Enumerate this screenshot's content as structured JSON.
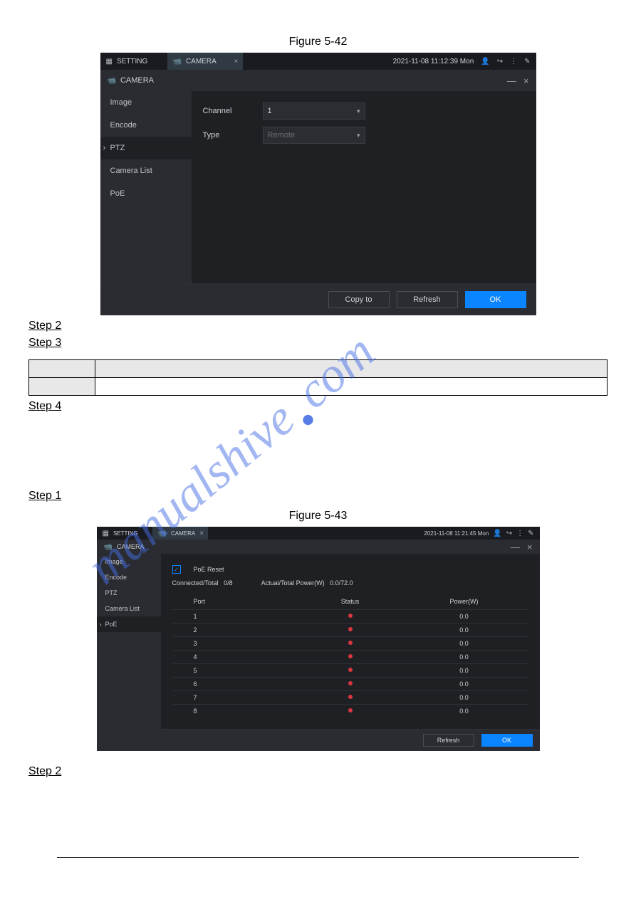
{
  "watermark": {
    "part1": "manualshive",
    "dot": ".",
    "part2": "com"
  },
  "figure1": {
    "caption": "Figure 5-42",
    "topbar": {
      "tab_setting": "SETTING",
      "tab_camera": "CAMERA",
      "datetime": "2021-11-08 11:12:39 Mon"
    },
    "subbar": {
      "title": "CAMERA"
    },
    "sidebar": {
      "items": [
        "Image",
        "Encode",
        "PTZ",
        "Camera List",
        "PoE"
      ],
      "active": 2
    },
    "form": {
      "rows": [
        {
          "label": "Channel",
          "value": "1",
          "disabled": false
        },
        {
          "label": "Type",
          "value": "Remote",
          "disabled": true
        }
      ]
    },
    "footer": {
      "copy": "Copy to",
      "refresh": "Refresh",
      "ok": "OK"
    }
  },
  "figure2": {
    "caption": "Figure 5-43",
    "topbar": {
      "tab_setting": "SETTING",
      "tab_camera": "CAMERA",
      "datetime": "2021-11-08 11:21:45 Mon"
    },
    "subbar": {
      "title": "CAMERA"
    },
    "sidebar": {
      "items": [
        "Image",
        "Encode",
        "PTZ",
        "Camera List",
        "PoE"
      ],
      "active": 4
    },
    "poe": {
      "checkbox_label": "PoE Reset",
      "stats": {
        "connected_label": "Connected/Total",
        "connected_val": "0/8",
        "power_label": "Actual/Total Power(W)",
        "power_val": "0.0/72.0"
      },
      "columns": [
        "Port",
        "Status",
        "Power(W)"
      ],
      "rows": [
        {
          "port": "1",
          "status": "red",
          "power": "0.0"
        },
        {
          "port": "2",
          "status": "red",
          "power": "0.0"
        },
        {
          "port": "3",
          "status": "red",
          "power": "0.0"
        },
        {
          "port": "4",
          "status": "red",
          "power": "0.0"
        },
        {
          "port": "5",
          "status": "red",
          "power": "0.0"
        },
        {
          "port": "6",
          "status": "red",
          "power": "0.0"
        },
        {
          "port": "7",
          "status": "red",
          "power": "0.0"
        },
        {
          "port": "8",
          "status": "red",
          "power": "0.0"
        }
      ]
    },
    "footer": {
      "refresh": "Refresh",
      "ok": "OK"
    }
  },
  "steps": {
    "step2a": "Step 2",
    "step3": "Step 3",
    "step4": "Step 4",
    "step1": "Step 1",
    "step2b": "Step 2"
  }
}
